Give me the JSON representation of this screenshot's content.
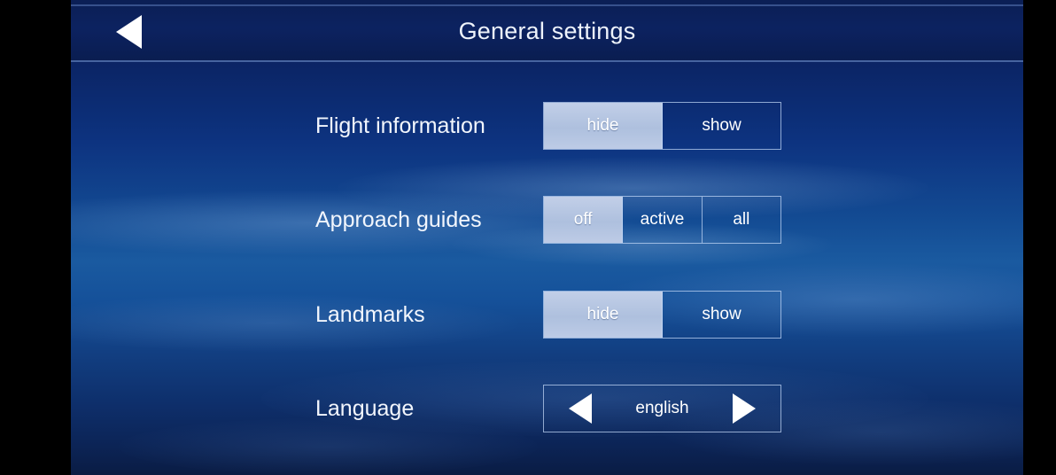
{
  "header": {
    "title": "General settings",
    "back_icon": "triangle-left-icon"
  },
  "settings": {
    "rows": [
      {
        "label": "Flight information",
        "type": "segmented",
        "options": [
          {
            "label": "hide",
            "selected": true
          },
          {
            "label": "show",
            "selected": false
          }
        ]
      },
      {
        "label": "Approach guides",
        "type": "segmented",
        "options": [
          {
            "label": "off",
            "selected": true
          },
          {
            "label": "active",
            "selected": false
          },
          {
            "label": "all",
            "selected": false
          }
        ]
      },
      {
        "label": "Landmarks",
        "type": "segmented",
        "options": [
          {
            "label": "hide",
            "selected": true
          },
          {
            "label": "show",
            "selected": false
          }
        ]
      },
      {
        "label": "Language",
        "type": "stepper",
        "value": "english",
        "prev_icon": "triangle-left-icon",
        "next_icon": "triangle-right-icon"
      }
    ]
  },
  "theme": {
    "selected_fill": "#aec0de",
    "border": "#c4d8f6",
    "text": "#ffffff",
    "header_bg": "#0c2260",
    "letterbox": "#000000"
  }
}
